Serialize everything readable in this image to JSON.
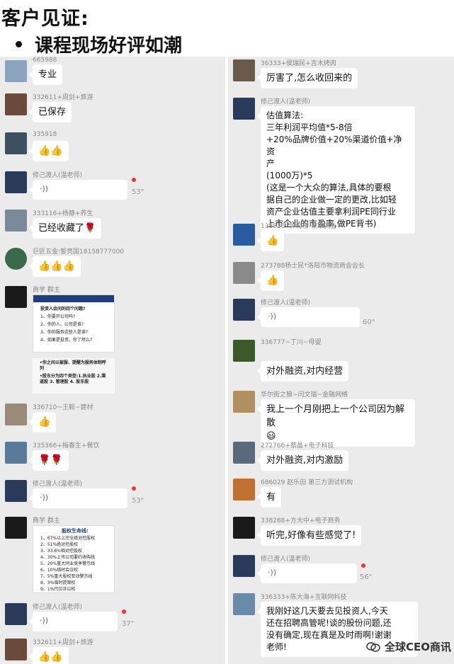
{
  "header": {
    "title": "客户见证:",
    "subtitle": "课程现场好评如潮"
  },
  "left": [
    {
      "sender": "665988",
      "text": "专业",
      "avatar": "#8aa4c0"
    },
    {
      "sender": "332611+周剑+旅游",
      "text": "已保存",
      "avatar": "#6b4a3a"
    },
    {
      "sender": "335918",
      "thumbs": "👍👍",
      "avatar": "#3d5060"
    },
    {
      "sender": "修己渡人(温老师)",
      "voice": "·))",
      "duration": "53\"",
      "avatar": "#2a3a5a"
    },
    {
      "sender": "333116+杨静+养生",
      "text": "已经收藏了🌹",
      "avatar": "#7a8a9a"
    },
    {
      "sender": "巨匠五金:誓亮国18158777000",
      "thumbs": "👍👍👍",
      "avatar": "#3a6a4a"
    },
    {
      "sender": "商学 群主",
      "avatar": "#1a1a1a"
    },
    {
      "sender": "336710~王毅~建材",
      "thumbs": "👍",
      "avatar": "#9a8a7a"
    },
    {
      "sender": "335366+梅春生+餐饮",
      "thumbs": "🌹🌹",
      "avatar": "#5a7a9a"
    },
    {
      "sender": "修己渡人(温老师)",
      "voice": "·))",
      "duration": "53\"",
      "avatar": "#2a3a5a"
    },
    {
      "sender": "商学 群主",
      "avatar": "#1a1a1a"
    },
    {
      "sender": "修己渡人(温老师)",
      "voice": "·))",
      "duration": "37\"",
      "avatar": "#2a3a5a"
    },
    {
      "sender": "332611+周剑+旅游",
      "thumbs": "👍👍",
      "avatar": "#6b4a3a"
    }
  ],
  "card1": {
    "title": "投资人会问的四个问题?",
    "lines": [
      "1、你要开公司吗?",
      "2、你的人、公司是谁?",
      "3、你的服务这些人是谁?",
      "4、如果是投资、你了然么?"
    ]
  },
  "card1b": {
    "lines": [
      "•你之间以被服、提醒为服务体制呼列",
      "•股东分为四个类型:1.执业股 2.渠道股 3. 管理股 4. 股东股"
    ]
  },
  "card2": {
    "title": "股权生命线:",
    "lines": [
      "1、67%以上完全绝对控股权",
      "2、51%绝对控股权",
      "3、33.6%相对控股权",
      "4、30%上市公司要约收购线",
      "5、20%重大同业竞争警示线",
      "6、10%临时会议权",
      "7、5%重大股权变动警示线",
      "8、3%临时提案权",
      "9、1%代位诉讼权"
    ]
  },
  "right": [
    {
      "sender": "36333+侯瑞民+吉木烤肉",
      "text": "厉害了,怎么收回来的",
      "avatar": "#6a5a4a"
    },
    {
      "sender": "修己渡人(温老师)",
      "avatar": "#2a3a5a",
      "lines": [
        "估值算法:",
        "三年利润平均值*5-8倍",
        "+20%品牌价值+20%渠道价值+净资",
        "产",
        "(1000万)*5",
        "(这是一个大众的算法,具体的要根",
        "据自己的企业做一定的更改,比如轻",
        "资产企业估值主要拿利润PE同行业",
        "上市企业的市盈率,做PE背书)"
      ]
    },
    {
      "sender": "138820--钟海东-果乐实业",
      "thumbs": "👍",
      "avatar": "#2a5aa0"
    },
    {
      "sender": "273788杨士民*洛阳市物流商会会长",
      "thumbs": "👍",
      "avatar": "#8a8a8a"
    },
    {
      "sender": "修己渡人(温老师)",
      "voice": "·))",
      "duration": "60\"",
      "avatar": "#2a3a5a"
    },
    {
      "sender": "336777~丁川~母婴",
      "text": "对外融资,对内经营",
      "avatar": "#3a5a2a"
    },
    {
      "sender": "华尔街之狼~闫文瑞~金融网络",
      "text": "我上一个月刚把上一个公司因为解散",
      "emoji": "😃",
      "avatar": "#b09060"
    },
    {
      "sender": "272766+蔡晶+电子科技",
      "text": "对外融资,对内激励",
      "avatar": "#5a6a7a"
    },
    {
      "sender": "686029 赵乐田 第三方测试机构",
      "text": "有",
      "avatar": "#c07030"
    },
    {
      "sender": "338288+方大中+电子商务",
      "text": "听完,好像有些感觉了!",
      "avatar": "#1a1a1a"
    },
    {
      "sender": "修己渡人(温老师)",
      "voice": "·))",
      "duration": "56\"",
      "avatar": "#2a3a5a"
    },
    {
      "sender": "336333+陈大海+互联网科技",
      "avatar": "#6a8aaa",
      "lines": [
        "我刚好这几天要去见投资人,今天",
        "还在招聘高管呢!谈的股份问题,还",
        "没有确定,现在真是及时雨啊!谢谢",
        "老师!"
      ]
    }
  ],
  "watermark": "全球CEO商讯"
}
